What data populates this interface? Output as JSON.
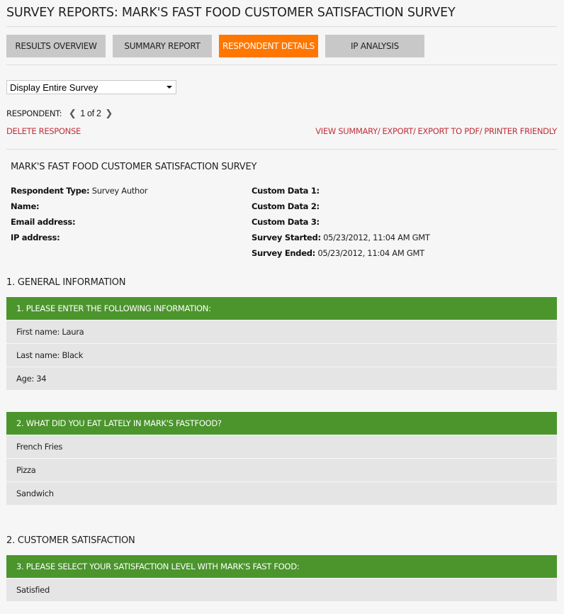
{
  "page": {
    "title": "SURVEY REPORTS: MARK'S FAST FOOD CUSTOMER SATISFACTION SURVEY"
  },
  "tabs": [
    {
      "label": "RESULTS OVERVIEW",
      "active": false
    },
    {
      "label": "SUMMARY REPORT",
      "active": false
    },
    {
      "label": "RESPONDENT DETAILS",
      "active": true
    },
    {
      "label": "IP ANALYSIS",
      "active": false
    }
  ],
  "colors": {
    "accent": "#ff7700",
    "tab_inactive": "#c8c8c8",
    "question_header": "#4b952c",
    "answer_bg": "#e5e5e5",
    "link_red": "#c0303a"
  },
  "display_select": {
    "selected": "Display Entire Survey"
  },
  "respondent_nav": {
    "label": "RESPONDENT:",
    "prev_icon": "chevron-left-icon",
    "next_icon": "chevron-right-icon",
    "count": "1 of 2"
  },
  "actions": {
    "delete": "DELETE RESPONSE",
    "view_summary": "VIEW SUMMARY/",
    "export": "EXPORT/",
    "export_pdf": "EXPORT TO PDF/",
    "printer_friendly": "PRINTER FRIENDLY"
  },
  "survey": {
    "name": "MARK'S FAST FOOD CUSTOMER SATISFACTION SURVEY",
    "meta_left": [
      {
        "label": "Respondent Type:",
        "value": "Survey Author"
      },
      {
        "label": "Name:",
        "value": ""
      },
      {
        "label": "Email address:",
        "value": ""
      },
      {
        "label": "IP address:",
        "value": ""
      }
    ],
    "meta_right": [
      {
        "label": "Custom Data 1:",
        "value": ""
      },
      {
        "label": "Custom Data 2:",
        "value": ""
      },
      {
        "label": "Custom Data 3:",
        "value": ""
      },
      {
        "label": "Survey Started:",
        "value": "05/23/2012, 11:04 AM GMT"
      },
      {
        "label": "Survey Ended:",
        "value": "05/23/2012, 11:04 AM GMT"
      }
    ]
  },
  "sections": [
    {
      "title": "1. GENERAL INFORMATION",
      "questions": [
        {
          "title": "1. PLEASE ENTER THE FOLLOWING INFORMATION:",
          "answers": [
            "First name: Laura",
            "Last name: Black",
            "Age: 34"
          ]
        },
        {
          "title": "2. WHAT DID YOU EAT LATELY IN MARK'S FASTFOOD?",
          "answers": [
            "French Fries",
            "Pizza",
            "Sandwich"
          ]
        }
      ]
    },
    {
      "title": "2. CUSTOMER SATISFACTION",
      "questions": [
        {
          "title": "3. PLEASE SELECT YOUR SATISFACTION LEVEL WITH MARK'S FAST FOOD:",
          "answers": [
            "Satisfied"
          ]
        }
      ]
    }
  ]
}
